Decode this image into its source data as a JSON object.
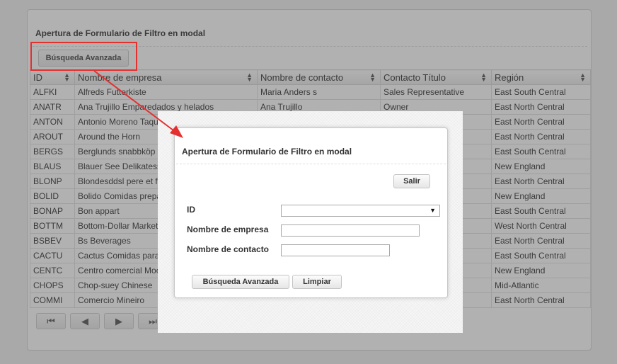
{
  "app": {
    "title": "Apertura de Formulario de Filtro en modal",
    "advanced_search_label": "Búsqueda Avanzada"
  },
  "grid": {
    "columns": [
      "ID",
      "Nombre de empresa",
      "Nombre de contacto",
      "Contacto Título",
      "Región"
    ],
    "rows": [
      [
        "ALFKI",
        "Alfreds Futterkiste",
        "Maria Anders s",
        "Sales Representative",
        "East South Central"
      ],
      [
        "ANATR",
        "Ana Trujillo Emparedados y helados",
        "Ana Trujillo",
        "Owner",
        "East North Central"
      ],
      [
        "ANTON",
        "Antonio Moreno Taquería",
        "",
        "",
        "East North Central"
      ],
      [
        "AROUT",
        "Around the Horn",
        "",
        "",
        "East North Central"
      ],
      [
        "BERGS",
        "Berglunds snabbköp",
        "",
        "",
        "East South Central"
      ],
      [
        "BLAUS",
        "Blauer See Delikatessen",
        "",
        "",
        "New England"
      ],
      [
        "BLONP",
        "Blondesddsl pere et fils",
        "",
        "",
        "East North Central"
      ],
      [
        "BOLID",
        "Bolido Comidas preparadas",
        "",
        "",
        "New England"
      ],
      [
        "BONAP",
        "Bon appart",
        "",
        "",
        "East South Central"
      ],
      [
        "BOTTM",
        "Bottom-Dollar Markets",
        "",
        "",
        "West North Central"
      ],
      [
        "BSBEV",
        "Bs Beverages",
        "",
        "",
        "East North Central"
      ],
      [
        "CACTU",
        "Cactus Comidas para llevar",
        "",
        "",
        "East South Central"
      ],
      [
        "CENTC",
        "Centro comercial Moctezuma",
        "",
        "",
        "New England"
      ],
      [
        "CHOPS",
        "Chop-suey Chinese",
        "",
        "",
        "Mid-Atlantic"
      ],
      [
        "COMMI",
        "Comercio Mineiro",
        "",
        "",
        "East North Central"
      ]
    ]
  },
  "pager": {
    "first": "⏮",
    "prev": "◀",
    "next": "▶",
    "last": "⏭"
  },
  "modal": {
    "title": "Apertura de Formulario de Filtro en modal",
    "exit_label": "Salir",
    "fields": {
      "id_label": "ID",
      "id_value": "",
      "company_label": "Nombre de empresa",
      "company_value": "",
      "contact_label": "Nombre de contacto",
      "contact_value": ""
    },
    "search_label": "Búsqueda Avanzada",
    "clear_label": "Limpiar"
  },
  "colors": {
    "annotation": "#e53030",
    "overlay": "#464646"
  }
}
